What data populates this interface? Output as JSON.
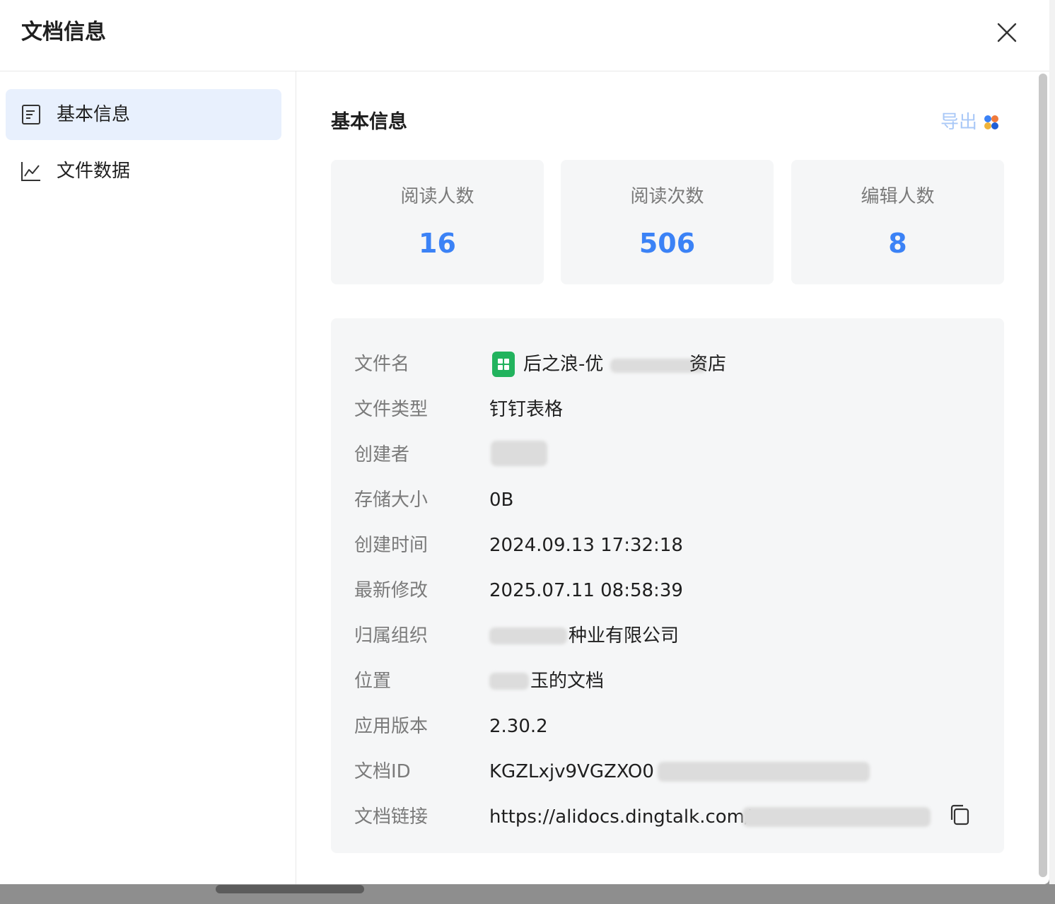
{
  "dialog": {
    "title": "文档信息"
  },
  "sidebar": {
    "items": [
      {
        "label": "基本信息",
        "icon": "document-list-icon",
        "active": true
      },
      {
        "label": "文件数据",
        "icon": "line-chart-icon",
        "active": false
      }
    ]
  },
  "main": {
    "section_title": "基本信息",
    "export_label": "导出",
    "stats": [
      {
        "label": "阅读人数",
        "value": "16"
      },
      {
        "label": "阅读次数",
        "value": "506"
      },
      {
        "label": "编辑人数",
        "value": "8"
      }
    ],
    "info": {
      "file_name": {
        "key": "文件名",
        "value": "后之浪-优",
        "value_tail": "资店"
      },
      "file_type": {
        "key": "文件类型",
        "value": "钉钉表格"
      },
      "creator": {
        "key": "创建者",
        "value": ""
      },
      "storage": {
        "key": "存储大小",
        "value": "0B"
      },
      "created_at": {
        "key": "创建时间",
        "value": "2024.09.13 17:32:18"
      },
      "modified_at": {
        "key": "最新修改",
        "value": "2025.07.11 08:58:39"
      },
      "org": {
        "key": "归属组织",
        "value_tail": "种业有限公司"
      },
      "location": {
        "key": "位置",
        "value_tail": "玉的文档"
      },
      "app_version": {
        "key": "应用版本",
        "value": "2.30.2"
      },
      "doc_id": {
        "key": "文档ID",
        "value": "KGZLxjv9VGZXO0"
      },
      "doc_link": {
        "key": "文档链接",
        "value": "https://alidocs.dingtalk.com/"
      }
    }
  },
  "colors": {
    "accent": "#3b82f6",
    "active_nav_bg": "#e8f0fd",
    "card_bg": "#f5f6f7",
    "sheet_icon_green": "#22b35e"
  }
}
